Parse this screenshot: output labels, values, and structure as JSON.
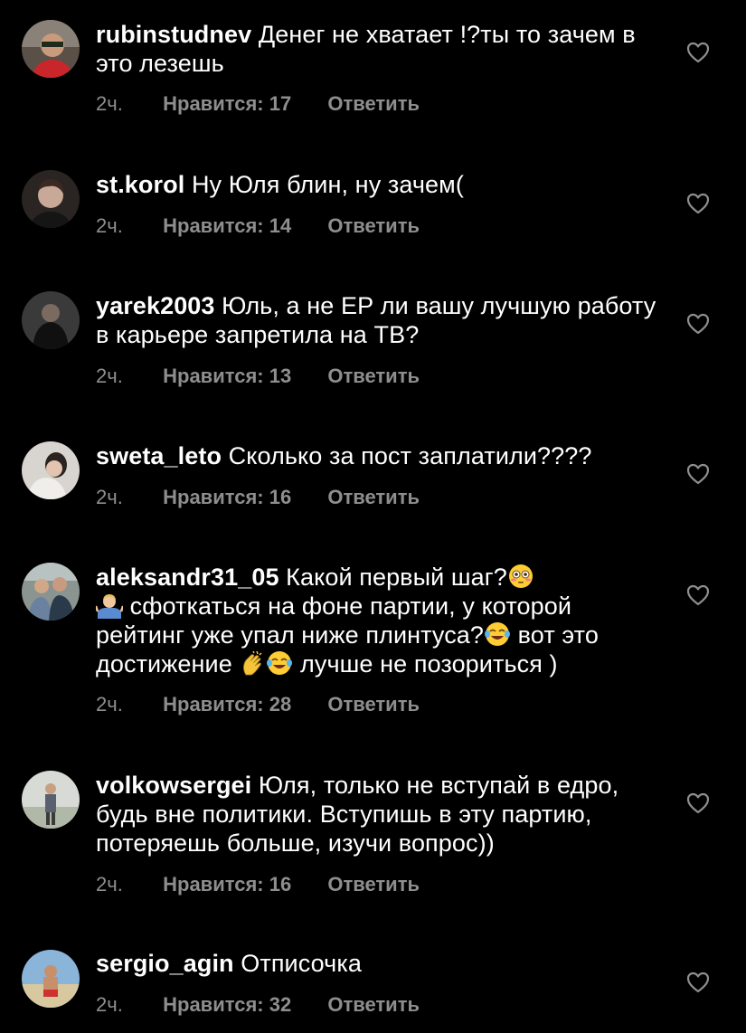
{
  "comments": [
    {
      "username": "rubinstudnev",
      "text": "Денег не хватает !?ты то зачем в это лезешь",
      "time": "2ч.",
      "likes": "Нравится: 17",
      "reply": "Ответить"
    },
    {
      "username": "st.korol",
      "text": "Ну Юля блин, ну зачем(",
      "time": "2ч.",
      "likes": "Нравится: 14",
      "reply": "Ответить"
    },
    {
      "username": "yarek2003",
      "text": "Юль, а не ЕР ли вашу лучшую работу в карьере запретила на ТВ?",
      "time": "2ч.",
      "likes": "Нравится: 13",
      "reply": "Ответить"
    },
    {
      "username": "sweta_leto",
      "text": "Сколько за пост заплатили????",
      "time": "2ч.",
      "likes": "Нравится: 16",
      "reply": "Ответить"
    },
    {
      "username": "aleksandr31_05",
      "text_1": "Какой первый шаг?",
      "text_2": "сфоткаться на фоне партии, у которой рейтинг уже упал ниже плинтуса?",
      "text_3": "вот это достижение",
      "text_4": "лучше не позориться )",
      "emojis": [
        "flushed-face-emoji",
        "person-shrugging-emoji",
        "tears-of-joy-emoji",
        "clapping-hands-emoji",
        "tears-of-joy-emoji"
      ],
      "time": "2ч.",
      "likes": "Нравится: 28",
      "reply": "Ответить"
    },
    {
      "username": "volkowsergei",
      "text": "Юля, только не вступай в едро, будь вне политики. Вступишь в эту партию, потеряешь больше, изучи вопрос))",
      "time": "2ч.",
      "likes": "Нравится: 16",
      "reply": "Ответить"
    },
    {
      "username": "sergio_agin",
      "text": "Отписочка",
      "time": "2ч.",
      "likes": "Нравится: 32",
      "reply": "Ответить"
    }
  ],
  "colors": {
    "background": "#000000",
    "text": "#ffffff",
    "meta": "#8e8e8e"
  }
}
